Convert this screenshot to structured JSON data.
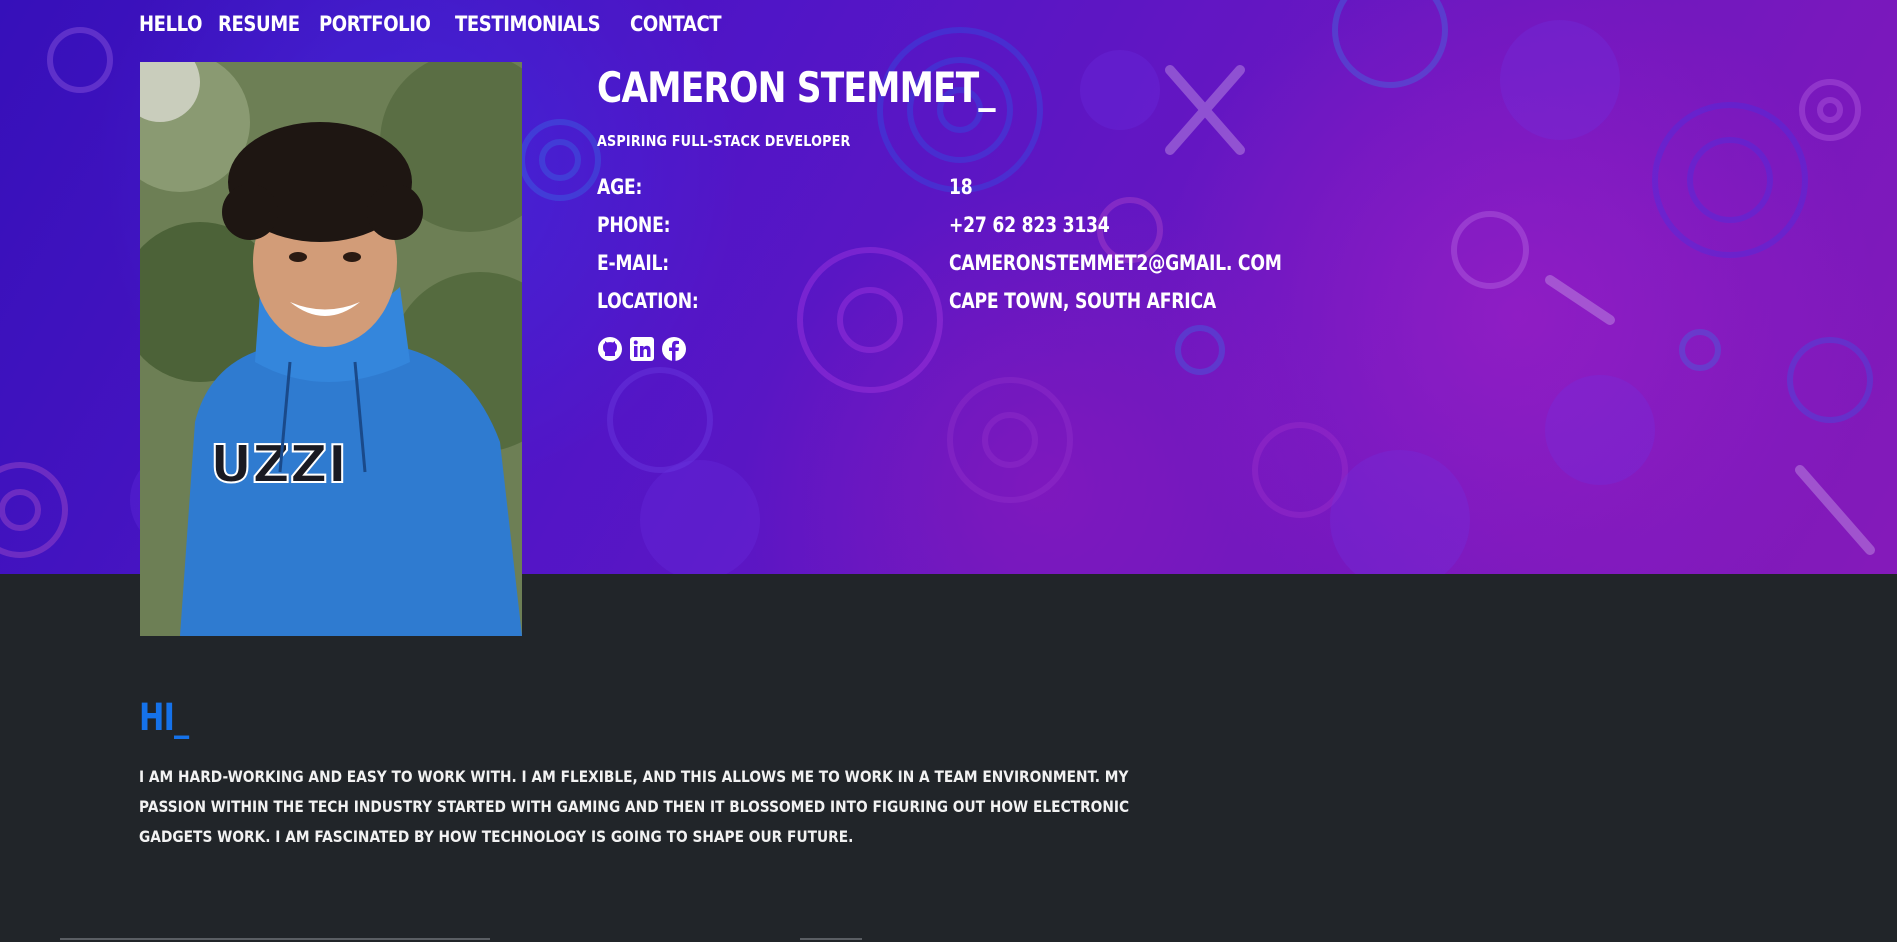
{
  "nav": {
    "items": [
      {
        "label": "HELLO"
      },
      {
        "label": "RESUME"
      },
      {
        "label": "PORTFOLIO"
      },
      {
        "label": "TESTIMONIALS"
      },
      {
        "label": "CONTACT"
      }
    ]
  },
  "profile": {
    "name": "CAMERON STEMMET_",
    "tagline": "ASPIRING FULL-STACK DEVELOPER",
    "details": [
      {
        "label": "AGE:",
        "value": "18"
      },
      {
        "label": "PHONE:",
        "value": "+27 62 823 3134"
      },
      {
        "label": "E-MAIL:",
        "value": "CAMERONSTEMMET2@GMAIL. COM"
      },
      {
        "label": "LOCATION:",
        "value": "CAPE TOWN, SOUTH AFRICA"
      }
    ],
    "photo_text": "UZZI",
    "socials": [
      "github-icon",
      "linkedin-icon",
      "facebook-icon"
    ]
  },
  "about": {
    "heading": "HI_",
    "body": "I AM HARD-WORKING AND EASY TO WORK WITH. I AM FLEXIBLE, AND THIS ALLOWS ME TO WORK IN A TEAM ENVIRONMENT. MY PASSION WITHIN THE TECH INDUSTRY STARTED WITH GAMING AND THEN IT BLOSSOMED INTO FIGURING OUT HOW ELECTRONIC GADGETS WORK. I AM FASCINATED BY HOW TECHNOLOGY IS GOING TO SHAPE OUR FUTURE."
  },
  "colors": {
    "accent": "#1572ea",
    "background": "#212529",
    "hero_purple": "#5a18d8"
  }
}
